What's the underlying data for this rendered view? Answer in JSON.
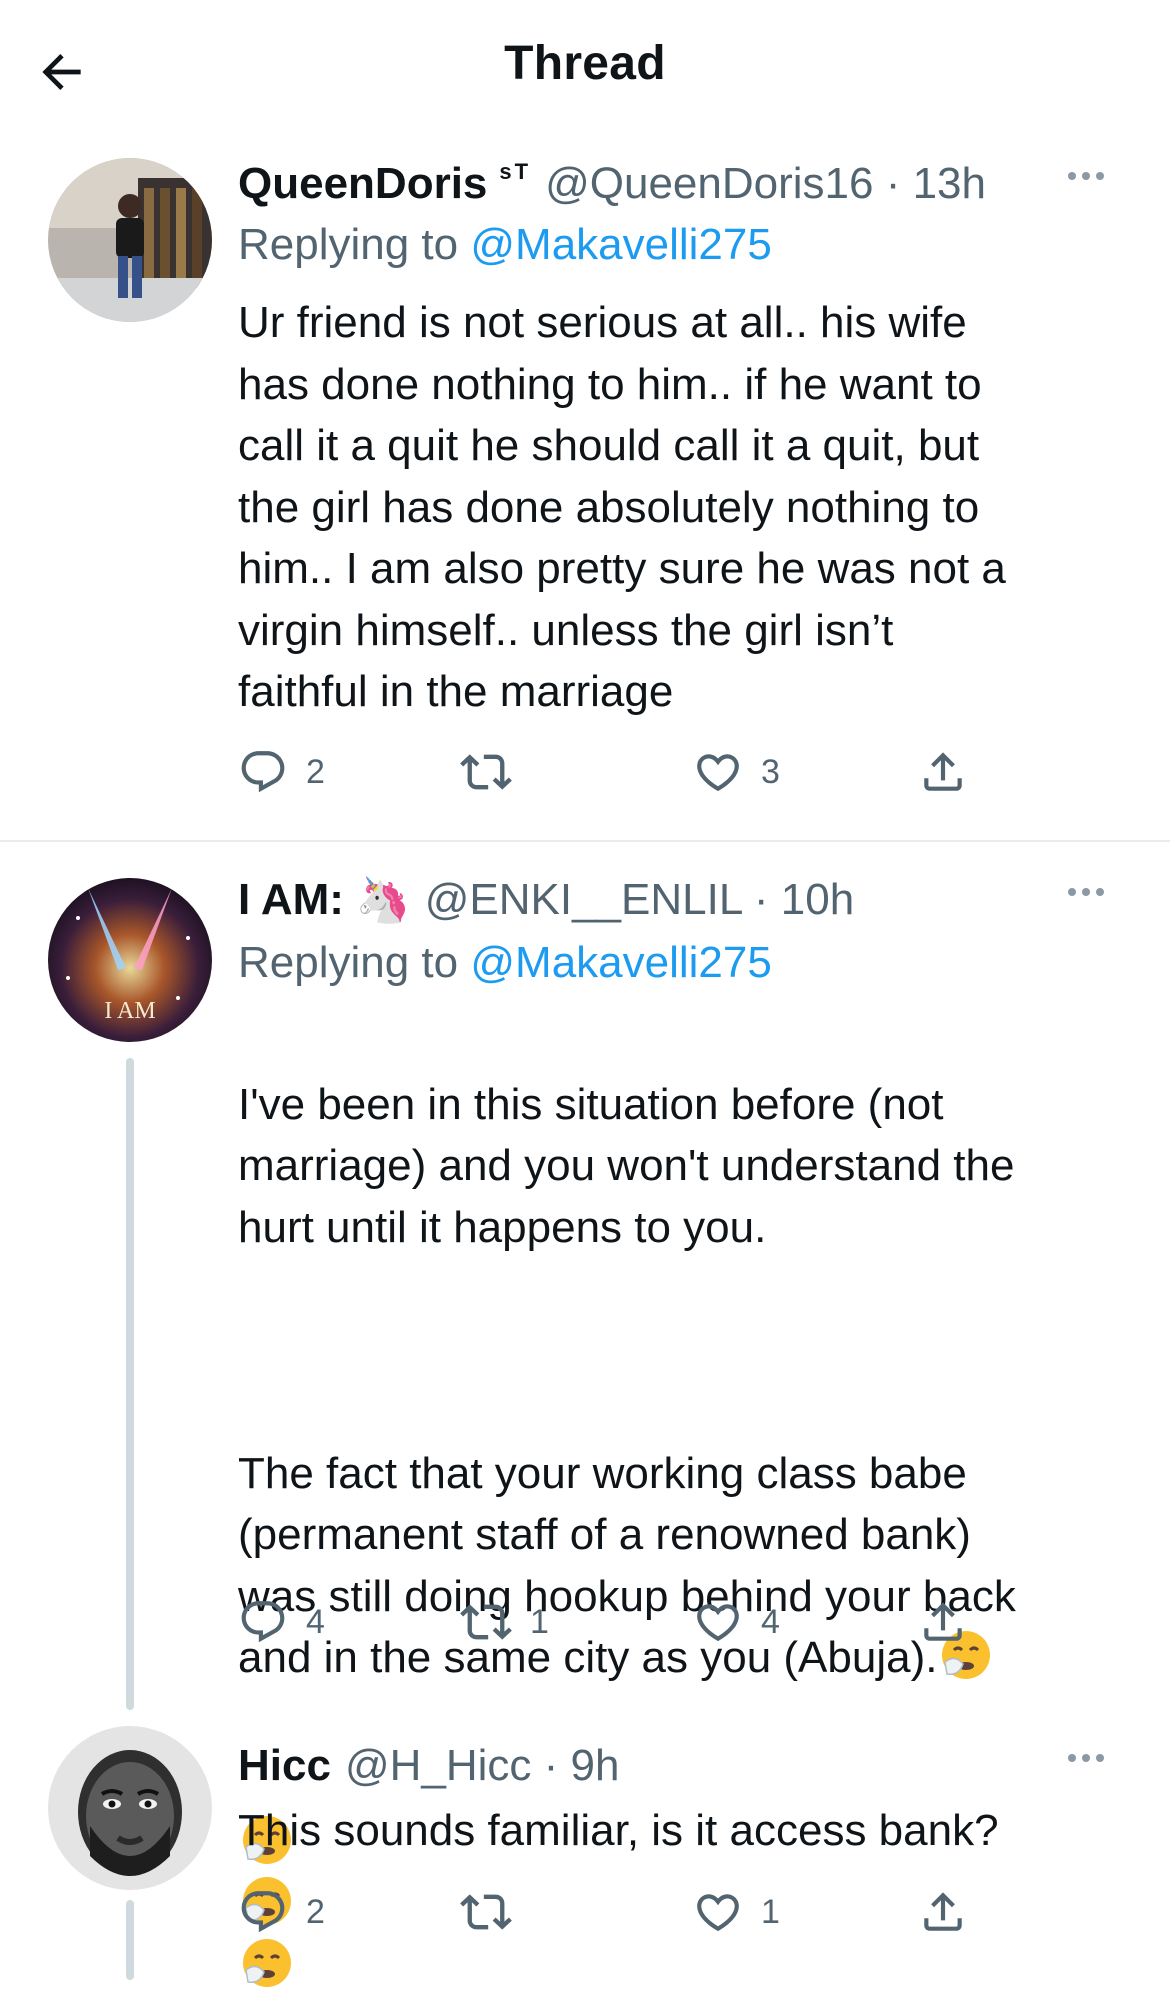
{
  "header": {
    "title": "Thread"
  },
  "tweets": [
    {
      "name": "QueenDoris",
      "badge": "sT",
      "handle_time": "@QueenDoris16 · 13h",
      "replying_prefix": "Replying to",
      "replying_to": "@Makavelli275",
      "body": "Ur friend is not serious at all.. his wife\nhas done nothing to him.. if he want to\ncall it a quit he should call it a quit, but\nthe girl has done absolutely nothing to\nhim.. I am also pretty sure he was not a\nvirgin himself.. unless the girl isn’t\nfaithful in the marriage",
      "replies": "2",
      "retweets": "",
      "likes": "3"
    },
    {
      "name": "I AM:",
      "name_emoji": "🦄",
      "handle_time": "@ENKI__ENLIL · 10h",
      "replying_prefix": "Replying to",
      "replying_to": "@Makavelli275",
      "body_p1": "I've been in this situation before (not\nmarriage) and you won't understand the\nhurt until it happens to you.",
      "body_p2": "The fact that your working class babe\n(permanent staff of a renowned bank)\nwas still doing hookup behind your back\nand in the same city as you (Abuja).",
      "replies": "4",
      "retweets": "1",
      "likes": "4",
      "avatar_text": "I AM"
    },
    {
      "name": "Hicc",
      "handle_time": "@H_Hicc · 9h",
      "body": "This sounds familiar, is it access bank?",
      "replies": "2",
      "retweets": "",
      "likes": "1"
    }
  ],
  "icons": {
    "back": "arrow-left-icon",
    "more": "more-horizontal-icon",
    "reply": "reply-icon",
    "retweet": "retweet-icon",
    "like": "heart-icon",
    "share": "share-icon",
    "sneeze": "sneezing-face-emoji"
  },
  "colors": {
    "link": "#1d9bf0",
    "secondary": "#536471",
    "text": "#0f1419",
    "thread_line": "#cfd9de"
  }
}
